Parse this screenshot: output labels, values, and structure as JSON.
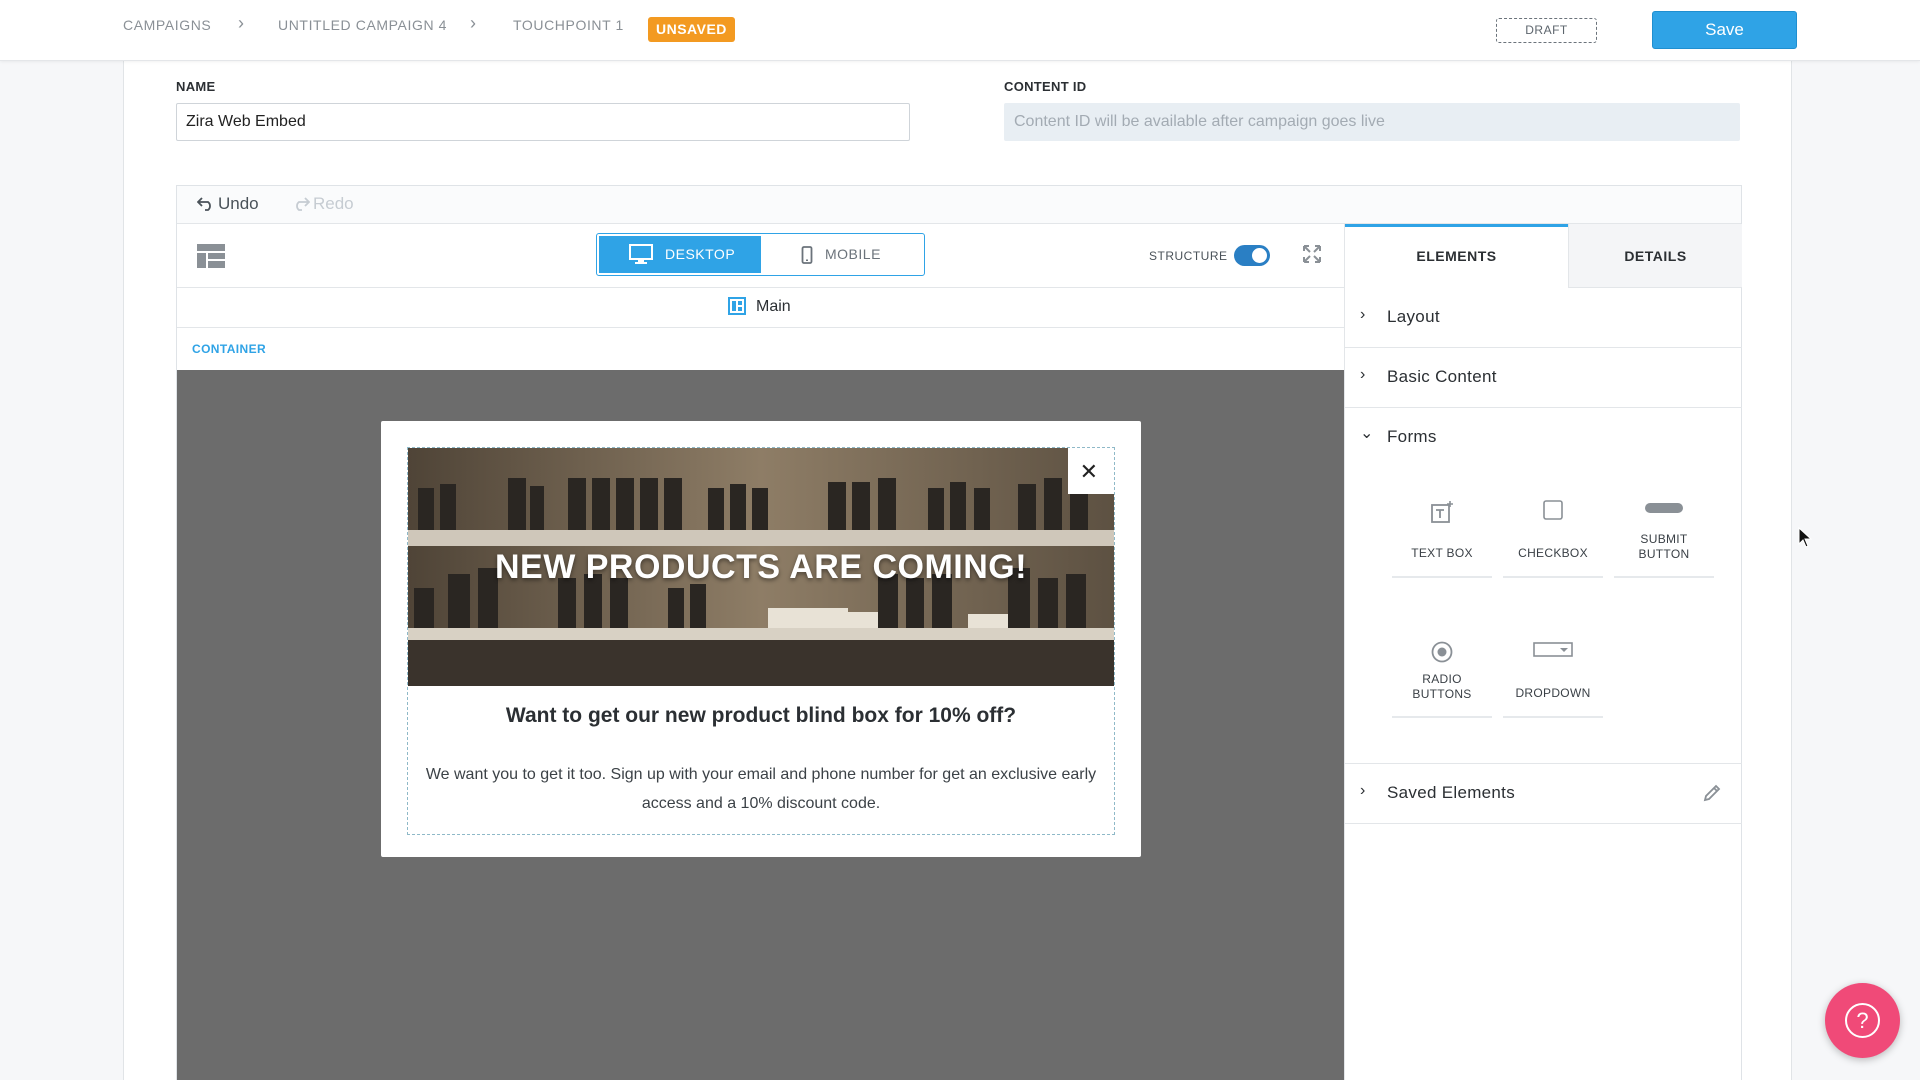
{
  "breadcrumb": {
    "items": [
      "CAMPAIGNS",
      "UNTITLED CAMPAIGN 4",
      "TOUCHPOINT 1"
    ],
    "status_badge": "UNSAVED"
  },
  "header": {
    "draft_label": "DRAFT",
    "save_label": "Save"
  },
  "form": {
    "name_label": "NAME",
    "name_value": "Zira Web Embed",
    "content_id_label": "CONTENT ID",
    "content_id_placeholder": "Content ID will be available after campaign goes live"
  },
  "editor": {
    "undo_label": "Undo",
    "redo_label": "Redo",
    "view_modes": [
      "DESKTOP",
      "MOBILE"
    ],
    "active_view": "DESKTOP",
    "structure_label": "STRUCTURE",
    "structure_on": true,
    "section_label": "Main",
    "container_label": "CONTAINER"
  },
  "popup": {
    "hero_title": "NEW PRODUCTS ARE COMING!",
    "headline": "Want to get our new product blind box for 10% off?",
    "body": "We want you to get it too. Sign up with your email and phone number for get an exclusive early access and a 10% discount code.",
    "close_icon": "close-icon"
  },
  "panel": {
    "tabs": [
      "ELEMENTS",
      "DETAILS"
    ],
    "active_tab": "ELEMENTS",
    "sections": {
      "layout": "Layout",
      "basic": "Basic Content",
      "forms": "Forms",
      "saved": "Saved Elements"
    },
    "form_elements": {
      "text_box": "TEXT BOX",
      "checkbox": "CHECKBOX",
      "submit_1": "SUBMIT",
      "submit_2": "BUTTON",
      "radio_1": "RADIO",
      "radio_2": "BUTTONS",
      "dropdown": "DROPDOWN"
    }
  },
  "colors": {
    "accent": "#2fa3e6",
    "badge": "#f39a21",
    "help": "#f04a78",
    "stage": "#6c6c6c"
  },
  "help_label": "?"
}
